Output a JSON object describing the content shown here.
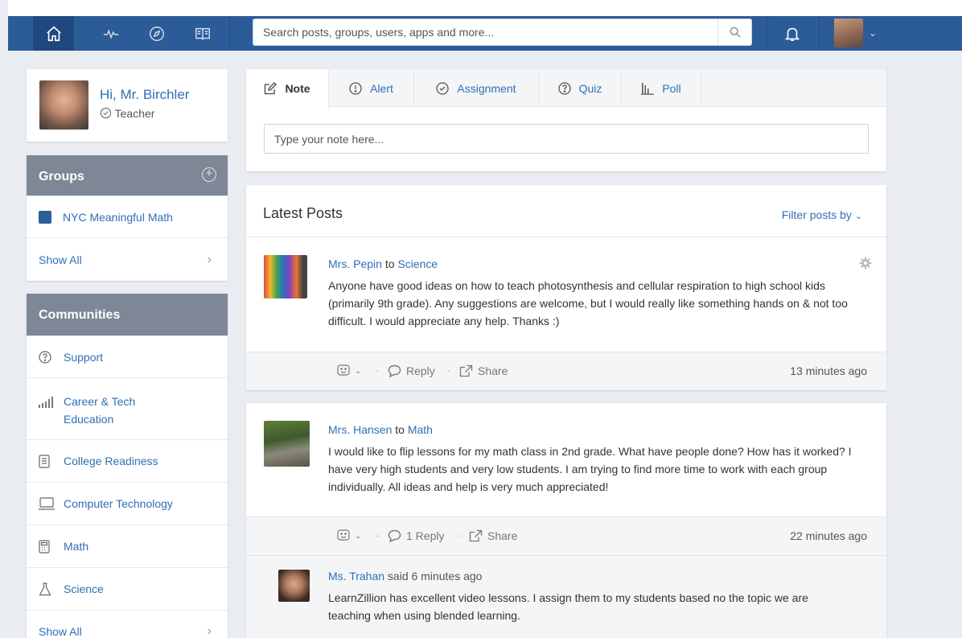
{
  "search": {
    "placeholder": "Search posts, groups, users, apps and more..."
  },
  "profile": {
    "greeting": "Hi, Mr. Birchler",
    "role": "Teacher"
  },
  "groups": {
    "title": "Groups",
    "items": [
      {
        "label": "NYC Meaningful Math",
        "color": "#2b5f9c"
      }
    ],
    "show_all": "Show All"
  },
  "communities": {
    "title": "Communities",
    "items": [
      {
        "label": "Support",
        "icon": "question-circle-icon"
      },
      {
        "label": "Career & Tech Education",
        "icon": "bar-chart-icon"
      },
      {
        "label": "College Readiness",
        "icon": "document-icon"
      },
      {
        "label": "Computer Technology",
        "icon": "monitor-icon"
      },
      {
        "label": "Math",
        "icon": "calculator-icon"
      },
      {
        "label": "Science",
        "icon": "flask-icon"
      }
    ],
    "show_all": "Show All"
  },
  "composer": {
    "tabs": [
      {
        "label": "Note",
        "icon": "edit-icon"
      },
      {
        "label": "Alert",
        "icon": "exclamation-circle-icon"
      },
      {
        "label": "Assignment",
        "icon": "check-circle-icon"
      },
      {
        "label": "Quiz",
        "icon": "question-circle-icon"
      },
      {
        "label": "Poll",
        "icon": "bar-chart-icon"
      }
    ],
    "placeholder": "Type your note here..."
  },
  "feed": {
    "title": "Latest Posts",
    "filter_label": "Filter posts by",
    "posts": [
      {
        "author": "Mrs. Pepin",
        "to_word": "to",
        "group": "Science",
        "text": "Anyone have good ideas on how to teach photosynthesis and cellular respiration to high school kids (primarily 9th grade). Any suggestions are welcome, but I would really like something hands on & not too difficult. I would appreciate any help. Thanks :)",
        "reply_label": "Reply",
        "share_label": "Share",
        "time": "13 minutes ago"
      },
      {
        "author": "Mrs. Hansen",
        "to_word": "to",
        "group": "Math",
        "text": "I would like to flip lessons for my math class in 2nd grade. What have people done? How has it worked? I have very high students and very low students. I am trying to find more time to work with each group individually. All ideas and help is very much appreciated!",
        "reply_label": "1 Reply",
        "share_label": "Share",
        "time": "22 minutes ago",
        "comment": {
          "author": "Ms. Trahan",
          "meta": "said 6 minutes ago",
          "text": "LearnZillion has excellent video lessons. I assign them to my students based no the topic we are teaching when using blended learning."
        }
      }
    ]
  }
}
